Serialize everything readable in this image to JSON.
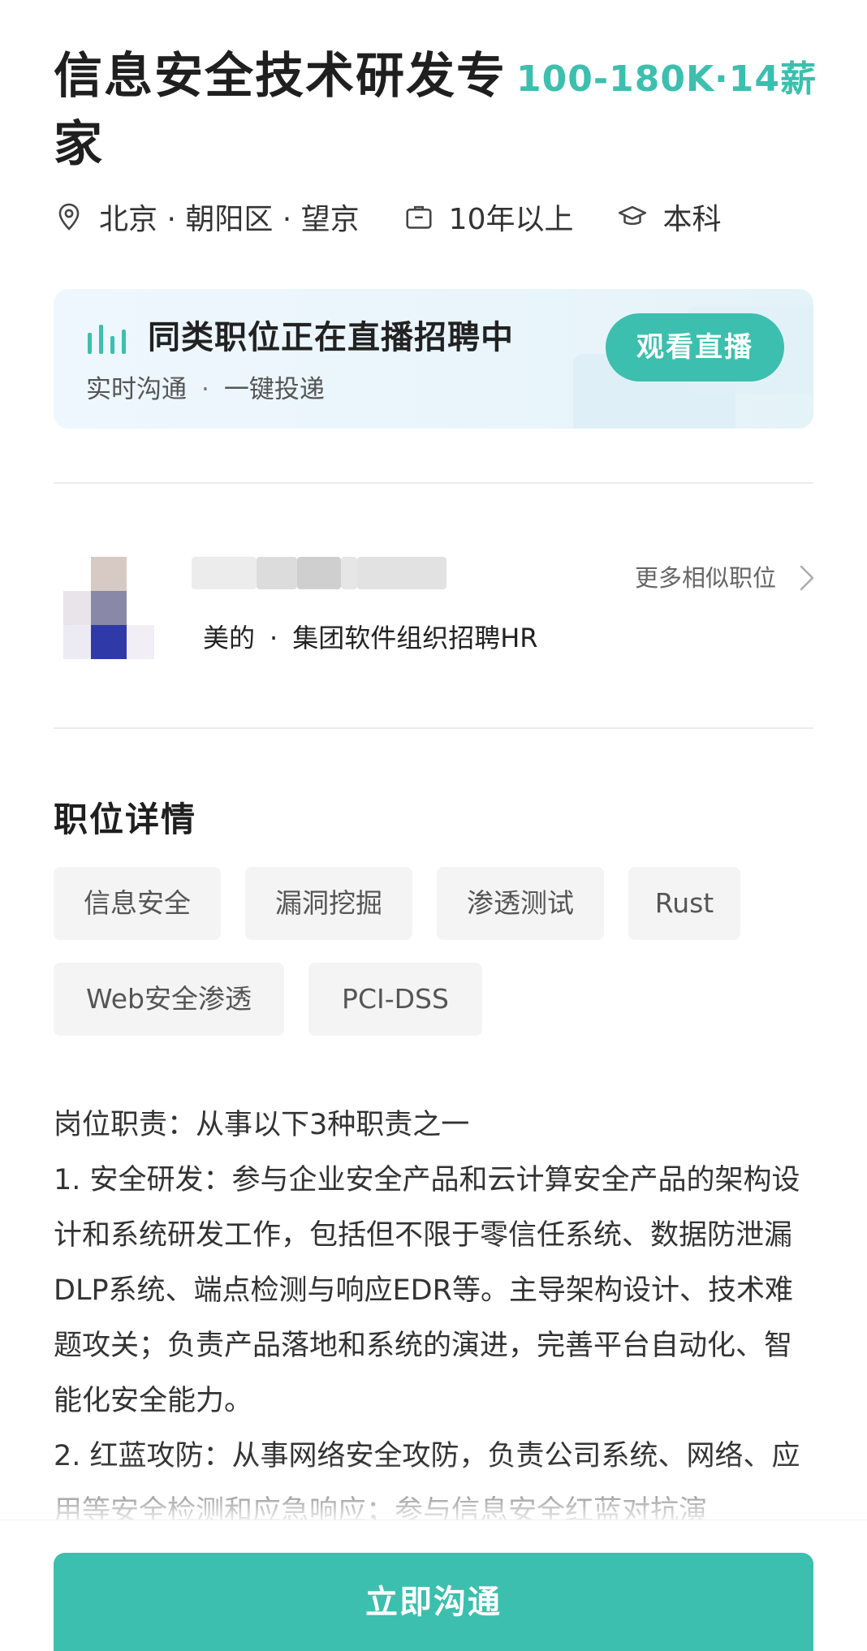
{
  "job": {
    "title": "信息安全技术研发专家",
    "salary": "100-180K·14薪",
    "location": "北京 · 朝阳区 · 望京",
    "experience": "10年以上",
    "education": "本科"
  },
  "live": {
    "title": "同类职位正在直播招聘中",
    "sub_left": "实时沟通",
    "sub_sep": "·",
    "sub_right": "一键投递",
    "button": "观看直播"
  },
  "hr": {
    "company": "美的",
    "sep": "·",
    "role": "集团软件组织招聘HR",
    "more_link": "更多相似职位"
  },
  "details": {
    "section_title": "职位详情",
    "tags": [
      "信息安全",
      "漏洞挖掘",
      "渗透测试",
      "Rust",
      "Web安全渗透",
      "PCI-DSS"
    ],
    "description": [
      "岗位职责：从事以下3种职责之一",
      "1. 安全研发：参与企业安全产品和云计算安全产品的架构设计和系统研发工作，包括但不限于零信任系统、数据防泄漏DLP系统、端点检测与响应EDR等。主导架构设计、技术难题攻关；负责产品落地和系统的演进，完善平台自动化、智能化安全能力。",
      "2. 红蓝攻防：从事网络安全攻防，负责公司系统、网络、应用等安全检测和应急响应；参与信息安全红蓝对抗演"
    ]
  },
  "bottom": {
    "chat_button": "立即沟通"
  },
  "colors": {
    "accent": "#3cbfae",
    "tag_bg": "#f4f4f4"
  }
}
